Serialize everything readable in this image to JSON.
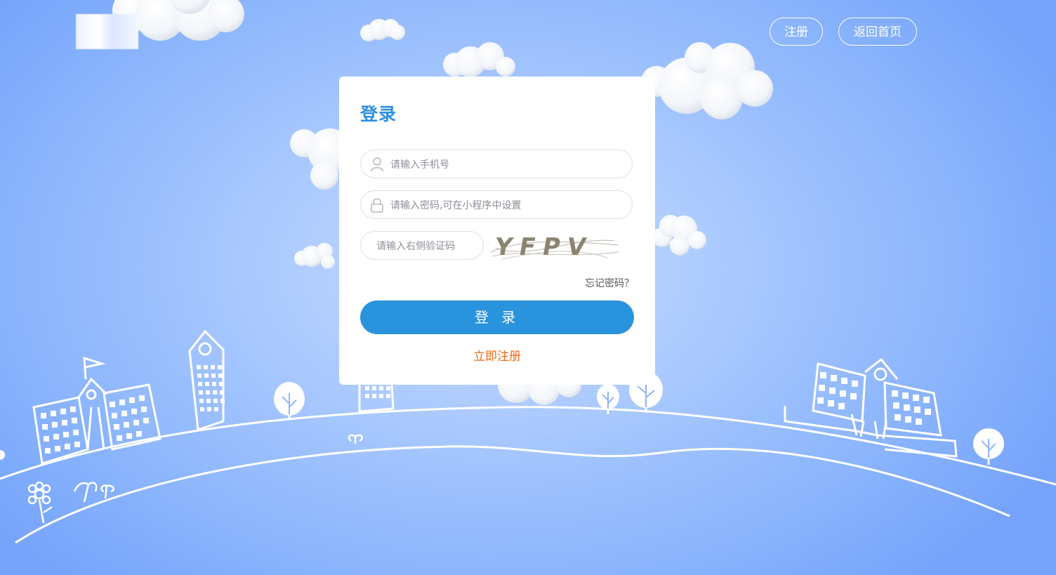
{
  "header": {
    "register_label": "注册",
    "home_label": "返回首页"
  },
  "login": {
    "title": "登录",
    "phone_placeholder": "请输入手机号",
    "password_placeholder": "请输入密码,可在小程序中设置",
    "captcha_placeholder": "请输入右侧验证码",
    "captcha_text": "YFPV",
    "forgot_label": "忘记密码？",
    "submit_label": "登 录",
    "register_link": "立即注册"
  },
  "icons": {
    "user": "user-icon",
    "lock": "lock-icon"
  },
  "colors": {
    "accent": "#2a93de",
    "title": "#2e8fdf",
    "register_link": "#ee6a1a"
  }
}
